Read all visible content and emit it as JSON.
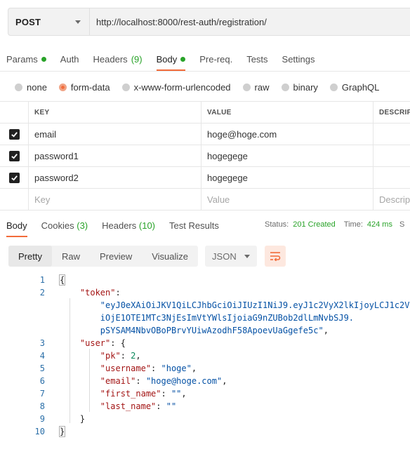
{
  "request": {
    "method": "POST",
    "url": "http://localhost:8000/rest-auth/registration/"
  },
  "request_tabs": [
    {
      "label": "Params",
      "dot": true
    },
    {
      "label": "Auth"
    },
    {
      "label": "Headers",
      "count": "(9)"
    },
    {
      "label": "Body",
      "dot": true,
      "active": true
    },
    {
      "label": "Pre-req."
    },
    {
      "label": "Tests"
    },
    {
      "label": "Settings"
    }
  ],
  "body_types": [
    {
      "label": "none"
    },
    {
      "label": "form-data",
      "selected": true
    },
    {
      "label": "x-www-form-urlencoded"
    },
    {
      "label": "raw"
    },
    {
      "label": "binary"
    },
    {
      "label": "GraphQL"
    }
  ],
  "table": {
    "headers": {
      "key": "KEY",
      "value": "VALUE",
      "description": "DESCRIPTI"
    },
    "rows": [
      {
        "checked": true,
        "key": "email",
        "value": "hoge@hoge.com",
        "description": ""
      },
      {
        "checked": true,
        "key": "password1",
        "value": "hogegege",
        "description": ""
      },
      {
        "checked": true,
        "key": "password2",
        "value": "hogegege",
        "description": ""
      }
    ],
    "placeholder": {
      "key": "Key",
      "value": "Value",
      "description": "Descripti"
    }
  },
  "response_tabs": [
    {
      "label": "Body",
      "active": true
    },
    {
      "label": "Cookies",
      "count": "(3)"
    },
    {
      "label": "Headers",
      "count": "(10)"
    },
    {
      "label": "Test Results"
    }
  ],
  "response_meta": {
    "status_label": "Status:",
    "status_value": "201 Created",
    "time_label": "Time:",
    "time_value": "424 ms",
    "size_label": "S"
  },
  "view_modes": [
    {
      "label": "Pretty",
      "active": true
    },
    {
      "label": "Raw"
    },
    {
      "label": "Preview"
    },
    {
      "label": "Visualize"
    }
  ],
  "format": "JSON",
  "code": {
    "line_numbers": [
      "1",
      "2",
      "",
      "",
      "3",
      "4",
      "5",
      "6",
      "7",
      "8",
      "9",
      "10"
    ],
    "token_key": "\"token\"",
    "token_lines": [
      "\"eyJ0eXAiOiJKV1QiLCJhbGciOiJIUzI1NiJ9.eyJ1c2VyX2lkIjoyLCJ1c2V",
      "iOjE1OTE1MTc3NjEsImVtYWlsIjoiaG9nZUBob2dlLmNvbSJ9.",
      "pSYSAM4NbvOBoPBrvYUiwAzodhF58ApoevUaGgefe5c\""
    ],
    "user_key": "\"user\"",
    "fields": [
      {
        "key": "\"pk\"",
        "value": "2",
        "type": "number"
      },
      {
        "key": "\"username\"",
        "value": "\"hoge\"",
        "type": "string"
      },
      {
        "key": "\"email\"",
        "value": "\"hoge@hoge.com\"",
        "type": "string"
      },
      {
        "key": "\"first_name\"",
        "value": "\"\"",
        "type": "string"
      },
      {
        "key": "\"last_name\"",
        "value": "\"\"",
        "type": "string"
      }
    ]
  },
  "colors": {
    "accent": "#f26b3a",
    "success": "#29a329",
    "json_key": "#a31515",
    "json_string": "#0451a5",
    "json_number": "#09885a",
    "line_number": "#2b6fa8"
  },
  "icons": {
    "method_caret": "chevron-down-icon",
    "format_caret": "chevron-down-icon",
    "wrap": "wrap-lines-icon",
    "checkbox": "checkmark-icon"
  }
}
